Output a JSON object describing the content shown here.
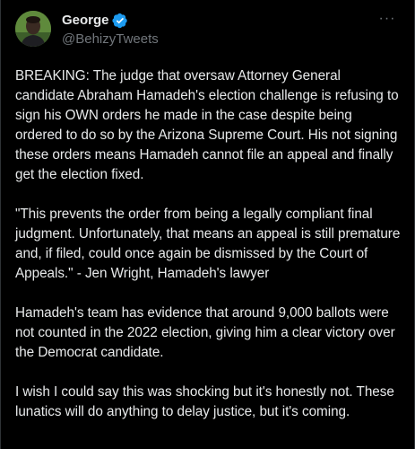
{
  "author": {
    "display_name": "George",
    "handle": "@BehizyTweets",
    "verified": true,
    "avatar_icon": "user-avatar-photo"
  },
  "menu": {
    "more_icon": "more-horizontal-icon",
    "more_glyph": "···"
  },
  "tweet": {
    "paragraphs": [
      "BREAKING: The judge that oversaw Attorney General candidate Abraham Hamadeh's election challenge is refusing to sign his OWN orders he made in the case despite being ordered to do so by the Arizona Supreme Court. His not signing these orders means Hamadeh cannot file an appeal and finally get the election fixed.",
      "\"This prevents the order from being a legally compliant final judgment. Unfortunately, that means an appeal is still premature and, if filed, could once again be dismissed by the Court of Appeals.\" - Jen Wright, Hamadeh's lawyer",
      "Hamadeh's team has evidence that around 9,000 ballots were not counted in the 2022 election, giving him a clear victory over the Democrat candidate.",
      "I wish I could say this was shocking but it's honestly not. These lunatics will do anything to delay justice, but it's coming."
    ]
  },
  "colors": {
    "background": "#000000",
    "text_primary": "#e7e9ea",
    "text_secondary": "#71767b",
    "verified_blue": "#1d9bf0",
    "border": "#2f3336"
  }
}
